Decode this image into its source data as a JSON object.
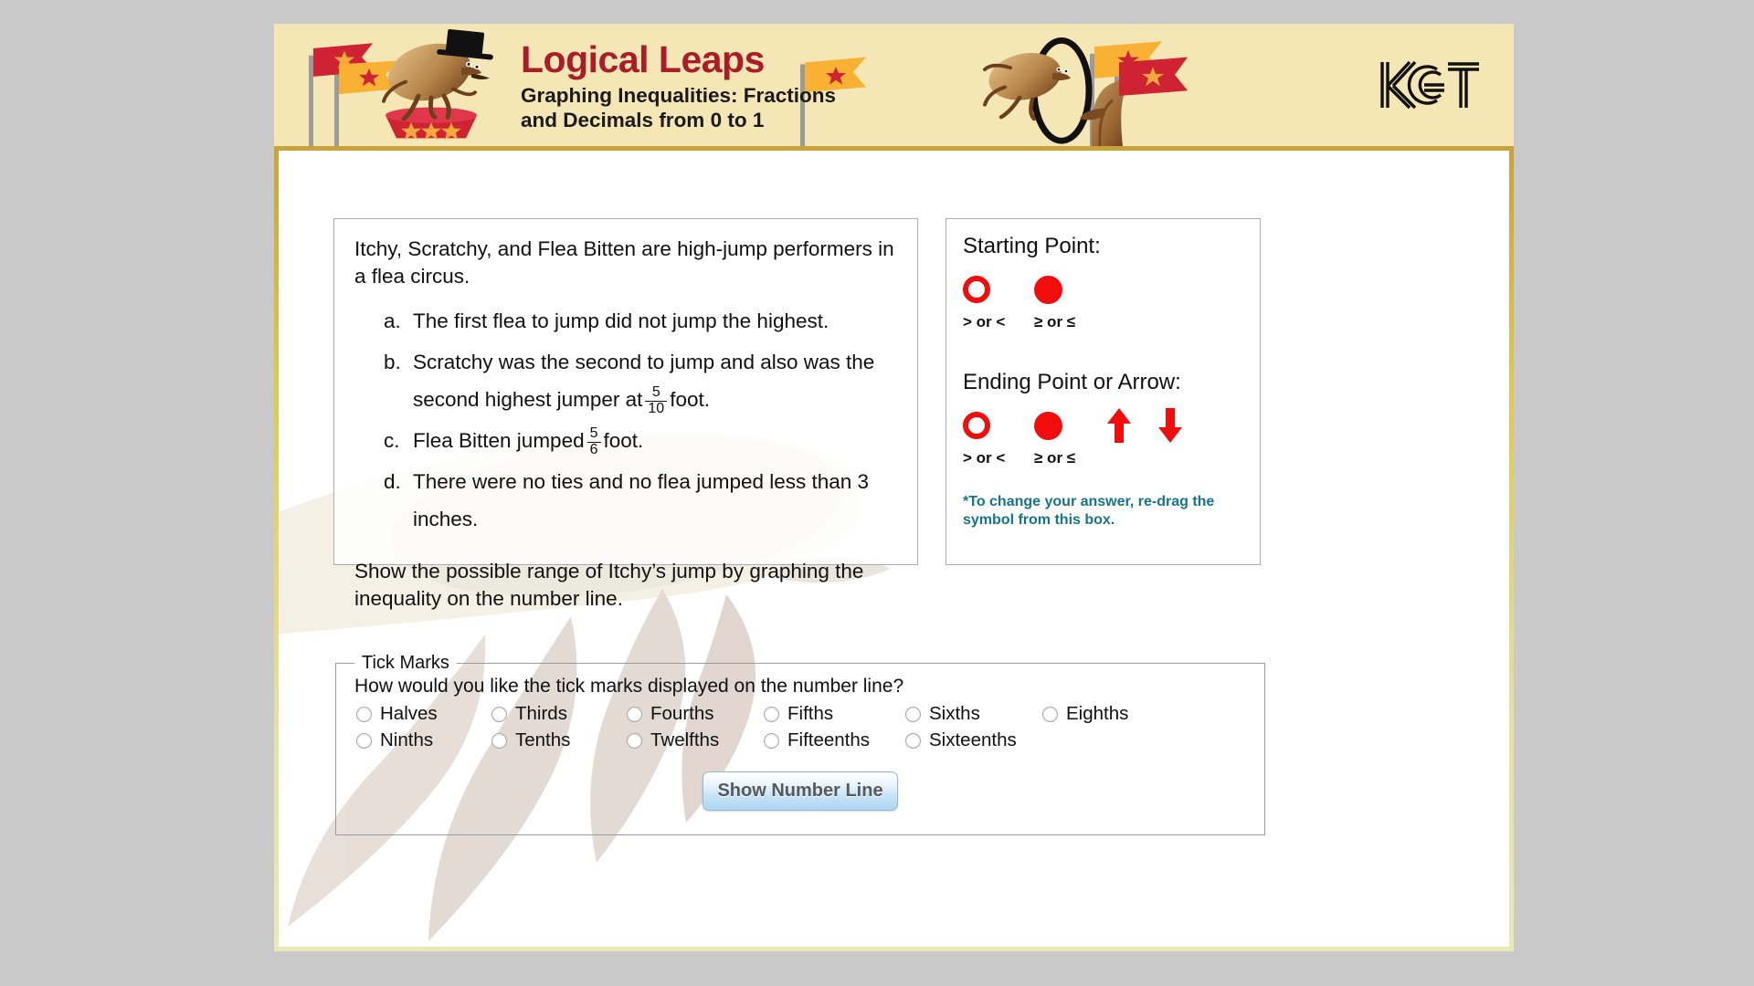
{
  "banner": {
    "title": "Logical Leaps",
    "subtitle_line1": "Graphing Inequalities: Fractions",
    "subtitle_line2": "and Decimals from 0 to 1",
    "logo_text": "KET",
    "bg_color": "#f5e6b6",
    "title_color": "#ab1b28"
  },
  "story": {
    "intro": "Itchy, Scratchy, and Flea Bitten are high-jump performers in a flea circus.",
    "clues": [
      {
        "marker": "a.",
        "text_before": "The first flea to jump did not jump the highest.",
        "fraction": null,
        "text_after": ""
      },
      {
        "marker": "b.",
        "text_before": "Scratchy was the second to jump and also was the second highest jumper at",
        "fraction": {
          "numerator": "5",
          "denominator": "10"
        },
        "text_after": "foot."
      },
      {
        "marker": "c.",
        "text_before": "Flea Bitten jumped",
        "fraction": {
          "numerator": "5",
          "denominator": "6"
        },
        "text_after": "foot."
      },
      {
        "marker": "d.",
        "text_before": "There were no ties and no flea jumped less than 3 inches.",
        "fraction": null,
        "text_after": ""
      }
    ],
    "task": "Show the possible range of Itchy’s jump by graphing the inequality on the number line."
  },
  "symbols": {
    "starting_heading": "Starting Point:",
    "starting_items": [
      {
        "icon": "open-circle-icon",
        "label": "> or <"
      },
      {
        "icon": "filled-circle-icon",
        "label": "≥ or ≤"
      }
    ],
    "ending_heading": "Ending Point or Arrow:",
    "ending_items": [
      {
        "icon": "open-circle-icon",
        "label": "> or <"
      },
      {
        "icon": "filled-circle-icon",
        "label": "≥ or ≤"
      },
      {
        "icon": "arrow-up-icon",
        "label": ""
      },
      {
        "icon": "arrow-down-icon",
        "label": ""
      }
    ],
    "note_line1": "*To change your answer, re-drag the",
    "note_line2": "symbol from this box.",
    "note_color": "#15738c",
    "symbol_color": "#f20c0c"
  },
  "tick_marks": {
    "legend": "Tick Marks",
    "question": "How would you like the tick marks displayed on the number line?",
    "options": [
      "Halves",
      "Thirds",
      "Fourths",
      "Fifths",
      "Sixths",
      "Eighths",
      "Ninths",
      "Tenths",
      "Twelfths",
      "Fifteenths",
      "Sixteenths"
    ],
    "selected": null,
    "button_label": "Show Number Line"
  }
}
